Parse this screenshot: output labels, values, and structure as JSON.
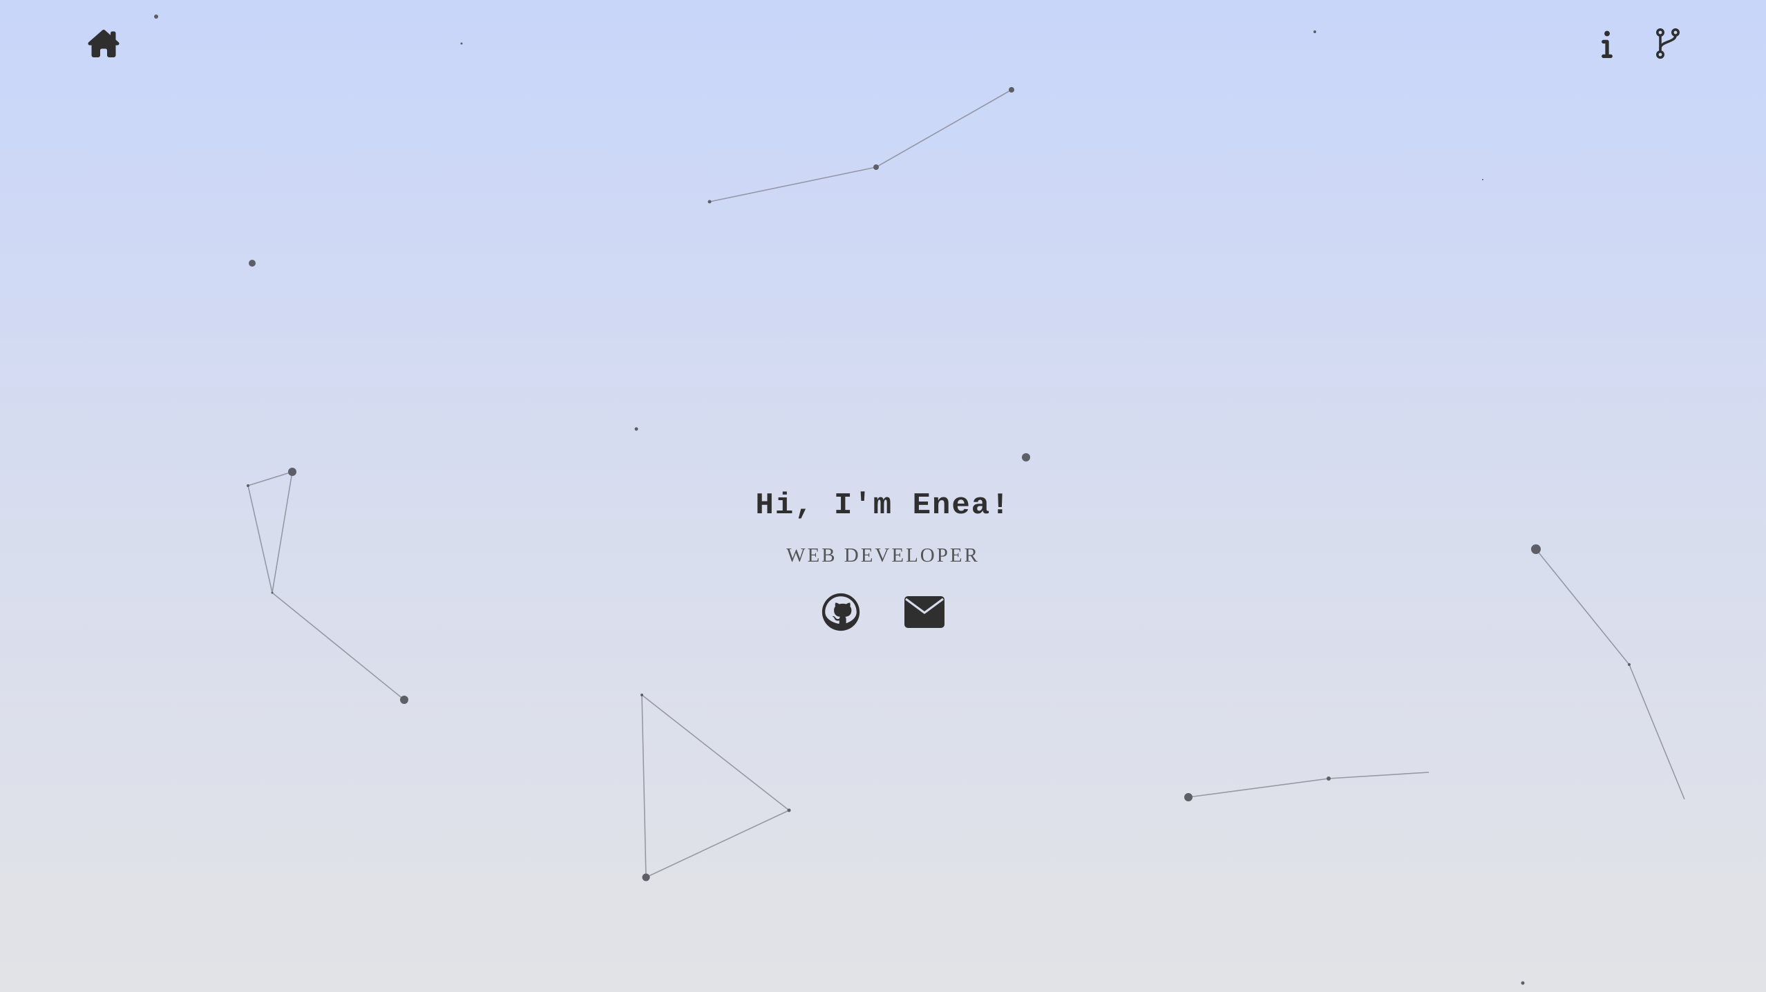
{
  "hero": {
    "title": "Hi, I'm Enea!",
    "subtitle": "WEB DEVELOPER"
  },
  "nav": {
    "left": [
      {
        "icon": "home-icon"
      }
    ],
    "right": [
      {
        "icon": "info-icon"
      },
      {
        "icon": "code-branch-icon"
      }
    ]
  },
  "social": [
    {
      "icon": "github-icon"
    },
    {
      "icon": "envelope-icon"
    }
  ],
  "colors": {
    "gradient_top": "#c8d6fa",
    "gradient_bottom": "#e2e3e6",
    "icon": "#2f2f2f",
    "subtitle": "#555555",
    "particle": "#5e5e66",
    "link_line": "#8a8c98"
  }
}
